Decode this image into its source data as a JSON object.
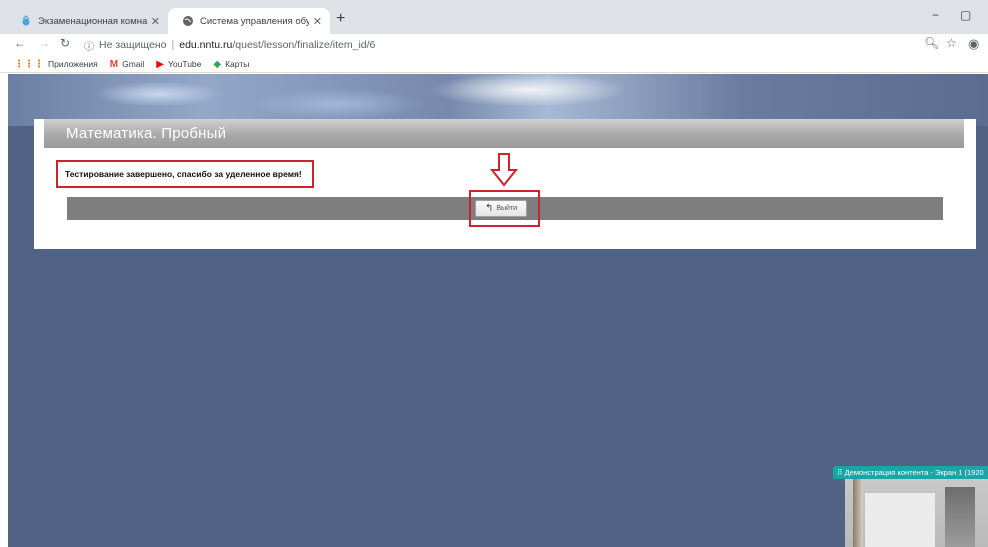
{
  "browser": {
    "tabs": [
      {
        "title": "Экзаменационная комната",
        "active": false
      },
      {
        "title": "Система управления обучением",
        "active": true
      }
    ],
    "new_tab": "+",
    "window_controls": {
      "minimize": "−",
      "restore": "▢"
    },
    "address": {
      "security_label": "Не защищено",
      "host": "edu.nntu.ru",
      "path": "/quest/lesson/finalize/item_id/6"
    },
    "bookmarks": [
      {
        "label": "Приложения",
        "icon": "apps-grid-icon"
      },
      {
        "label": "Gmail",
        "icon": "gmail-icon"
      },
      {
        "label": "YouTube",
        "icon": "youtube-icon"
      },
      {
        "label": "Карты",
        "icon": "maps-icon"
      }
    ]
  },
  "page": {
    "header_title": "Математика. Пробный",
    "message": "Тестирование завершено, спасибо за уделенное время!",
    "exit_button": "Выйти"
  },
  "overlay": {
    "label": "⠿ Демонстрация контента - Экран 1 (1920"
  },
  "colors": {
    "page_background": "#516384",
    "annotation_red": "#c8252c",
    "overlay_teal": "#1aa6a6"
  }
}
